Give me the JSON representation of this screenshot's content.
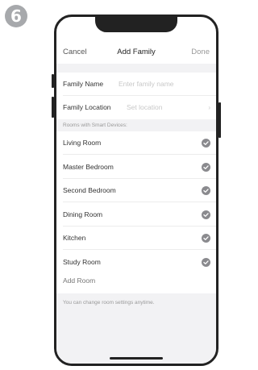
{
  "step_number": "6",
  "nav": {
    "cancel_label": "Cancel",
    "title": "Add Family",
    "done_label": "Done"
  },
  "form": {
    "family_name_label": "Family Name",
    "family_name_placeholder": "Enter family name",
    "family_location_label": "Family Location",
    "family_location_placeholder": "Set location"
  },
  "rooms": {
    "section_header": "Rooms with Smart Devices:",
    "items": [
      {
        "label": "Living Room",
        "checked": true
      },
      {
        "label": "Master Bedroom",
        "checked": true
      },
      {
        "label": "Second Bedroom",
        "checked": true
      },
      {
        "label": "Dining Room",
        "checked": true
      },
      {
        "label": "Kitchen",
        "checked": true
      },
      {
        "label": "Study Room",
        "checked": true
      }
    ],
    "add_room_label": "Add Room"
  },
  "footer_note": "You can change room settings anytime.",
  "icons": {
    "check": "checkmark-circle-icon",
    "chevron": "chevron-right-icon"
  },
  "colors": {
    "check_fill": "#8a8a8e",
    "badge_fill": "#a7a9ac"
  }
}
